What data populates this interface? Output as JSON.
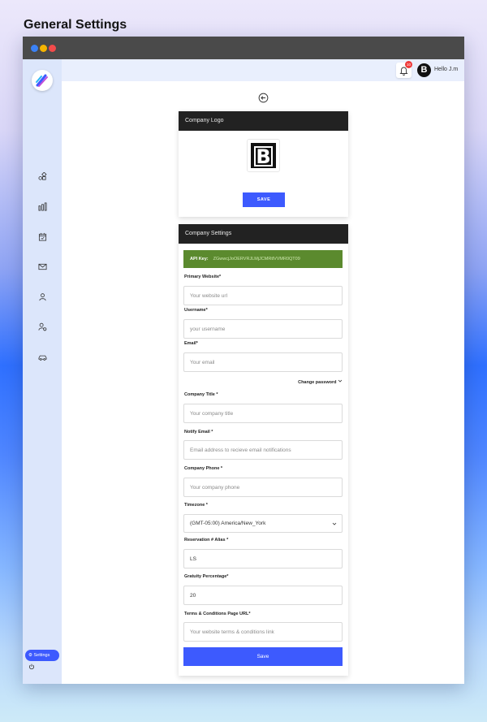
{
  "page": {
    "title": "General Settings"
  },
  "topbar": {
    "notification_count": "10",
    "avatar_letter": "B",
    "greeting": "Hello J.m"
  },
  "sidebar": {
    "items": [
      {
        "icon": "apps-icon"
      },
      {
        "icon": "bar-chart-icon"
      },
      {
        "icon": "calendar-icon"
      },
      {
        "icon": "mail-icon"
      },
      {
        "icon": "users-icon"
      },
      {
        "icon": "user-settings-icon"
      },
      {
        "icon": "car-icon"
      }
    ],
    "settings_label": "Settings"
  },
  "logo_card": {
    "header": "Company Logo",
    "logo_letter": "B",
    "save_label": "SAVE"
  },
  "company_card": {
    "header": "Company Settings",
    "api_key_label": "API Key:",
    "api_key_value": "ZGwwcjJoOERVRJLMjJCMRtlVVMR0QT09",
    "change_password_label": "Change password",
    "fields": {
      "primary_website": {
        "label": "Primary Website*",
        "placeholder": "Your website url",
        "value": ""
      },
      "username": {
        "label": "Username*",
        "placeholder": "your username",
        "value": ""
      },
      "email": {
        "label": "Email*",
        "placeholder": "Your email",
        "value": ""
      },
      "company_title": {
        "label": "Company Title *",
        "placeholder": "Your company title",
        "value": ""
      },
      "notify_email": {
        "label": "Notify Email *",
        "placeholder": "Email address to recieve email notifications",
        "value": ""
      },
      "company_phone": {
        "label": "Company Phone *",
        "placeholder": "Your company phone",
        "value": ""
      },
      "timezone": {
        "label": "Timezone *",
        "value": "(GMT-05:00) America/New_York"
      },
      "reservation_alias": {
        "label": "Reservation # Alias *",
        "placeholder": "",
        "value": "LS"
      },
      "gratuity_percentage": {
        "label": "Gratuity Percentage*",
        "placeholder": "",
        "value": "20"
      },
      "terms_url": {
        "label": "Terms & Conditions Page URL*",
        "placeholder": "Your website terms & conditions link",
        "value": ""
      }
    },
    "save_label": "Save"
  },
  "colors": {
    "accent": "#3d5afe",
    "header_dark": "#222222",
    "api_green": "#5b8a2e",
    "sidebar_bg": "#dce6fb"
  }
}
